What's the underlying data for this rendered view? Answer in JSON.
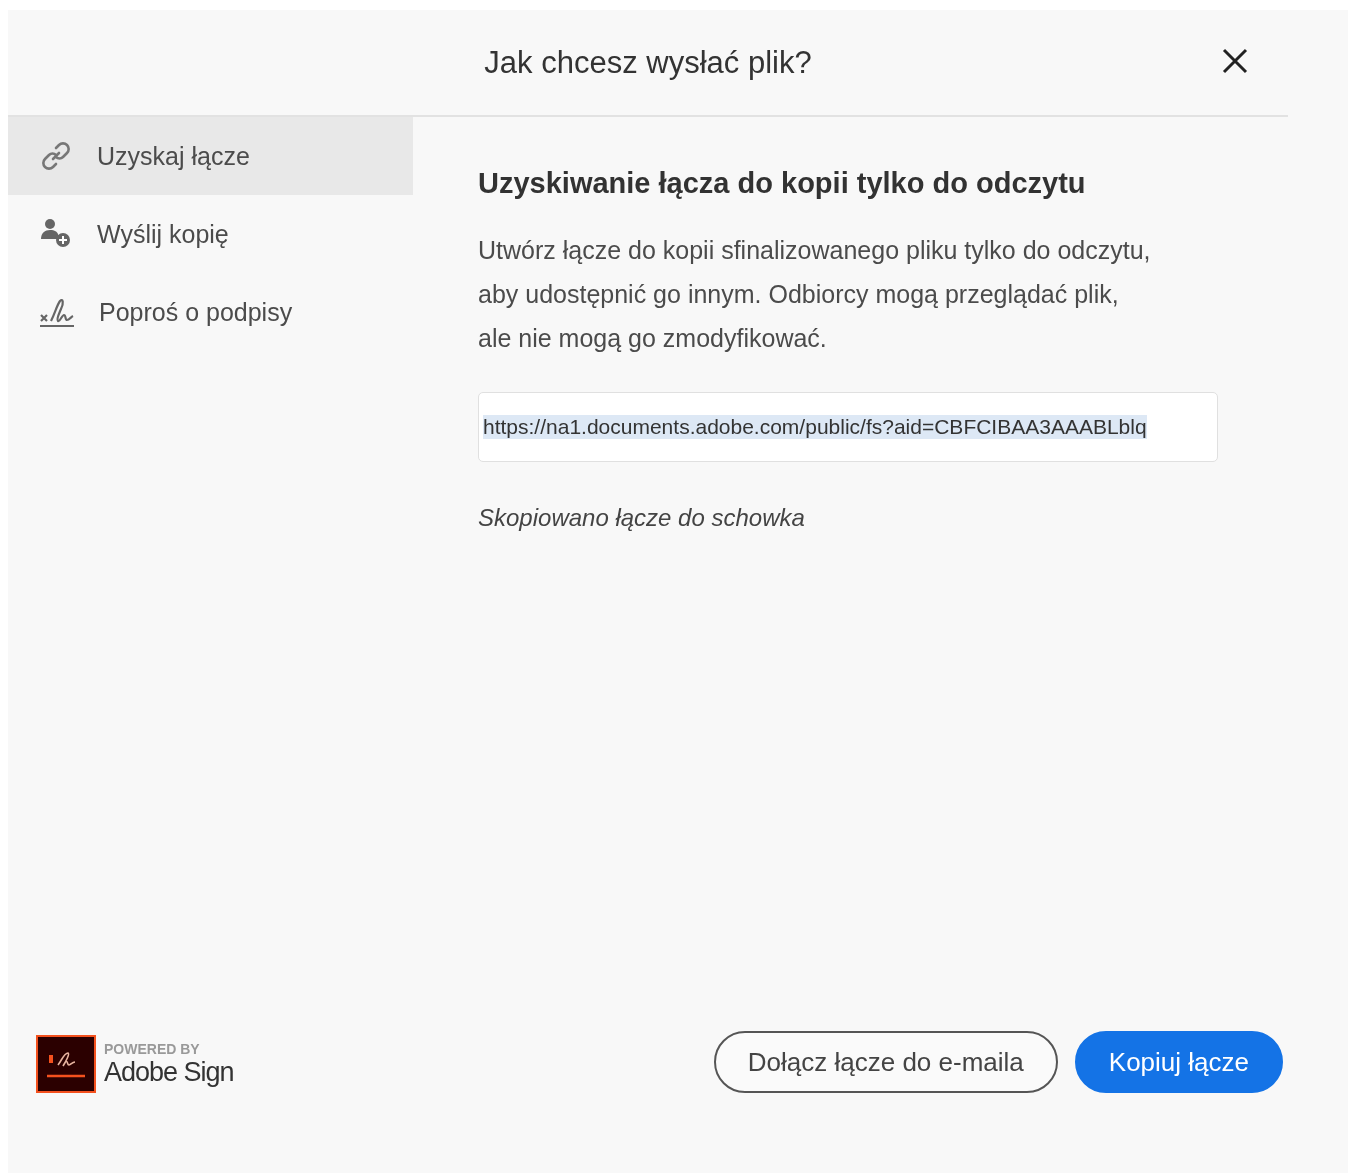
{
  "dialog": {
    "title": "Jak chcesz wysłać plik?"
  },
  "sidebar": {
    "items": [
      {
        "kind": "link",
        "label": "Uzyskaj łącze",
        "selected": true
      },
      {
        "kind": "send",
        "label": "Wyślij kopię",
        "selected": false
      },
      {
        "kind": "sign",
        "label": "Poproś o podpisy",
        "selected": false
      }
    ],
    "branding": {
      "caption": "POWERED BY",
      "product": "Adobe Sign"
    }
  },
  "main": {
    "heading": "Uzyskiwanie łącza do kopii tylko do odczytu",
    "description": "Utwórz łącze do kopii sfinalizowanego pliku tylko do odczytu, aby udostępnić go innym. Odbiorcy mogą przeglądać plik, ale nie mogą go zmodyfikować.",
    "link_field": {
      "value": "https://na1.documents.adobe.com/public/fs?aid=CBFCIBAA3AAABLblq",
      "text_selected": true
    },
    "status": "Skopiowano łącze do schowka",
    "buttons": [
      {
        "kind": "secondary",
        "label": "Dołącz łącze do e-maila"
      },
      {
        "kind": "primary",
        "label": "Kopiuj łącze"
      }
    ]
  }
}
